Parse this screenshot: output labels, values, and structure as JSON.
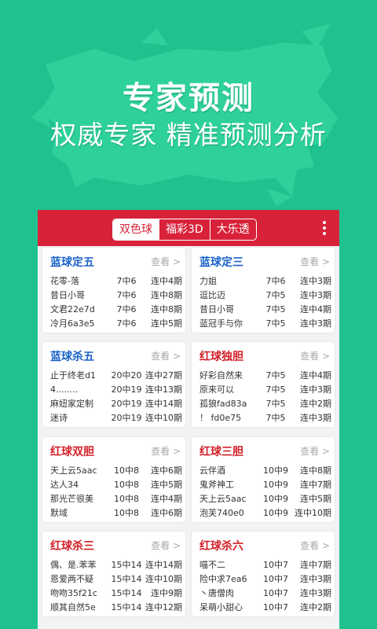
{
  "hero": {
    "title": "专家预测",
    "subtitle": "权威专家 精准预测分析"
  },
  "tabs": [
    {
      "label": "双色球",
      "active": true
    },
    {
      "label": "福彩3D",
      "active": false
    },
    {
      "label": "大乐透",
      "active": false
    }
  ],
  "view_label": "查看 >",
  "colors": {
    "background": "#1fc28f",
    "hero_shape": "#2ed19a",
    "header": "#d8223a",
    "blue_title": "#1a62c8",
    "red_title": "#d21f28"
  },
  "cards": [
    {
      "title": "蓝球定五",
      "color": "blue",
      "rows": [
        {
          "name": "花零-落",
          "hits": "7中6",
          "streak": "连中4期"
        },
        {
          "name": "昔日小哥",
          "hits": "7中6",
          "streak": "连中8期"
        },
        {
          "name": "文君22e7d",
          "hits": "7中6",
          "streak": "连中8期"
        },
        {
          "name": "冷月6a3e5",
          "hits": "7中6",
          "streak": "连中5期"
        }
      ]
    },
    {
      "title": "蓝球定三",
      "color": "blue",
      "rows": [
        {
          "name": "力姐",
          "hits": "7中6",
          "streak": "连中3期"
        },
        {
          "name": "逗比迈",
          "hits": "7中5",
          "streak": "连中3期"
        },
        {
          "name": "昔日小哥",
          "hits": "7中5",
          "streak": "连中4期"
        },
        {
          "name": "蓝冠手与你",
          "hits": "7中5",
          "streak": "连中3期"
        }
      ]
    },
    {
      "title": "蓝球杀五",
      "color": "blue",
      "rows": [
        {
          "name": "止于终老d1",
          "hits": "20中20",
          "streak": "连中27期"
        },
        {
          "name": "4........",
          "hits": "20中19",
          "streak": "连中13期"
        },
        {
          "name": "麻妞家定制",
          "hits": "20中19",
          "streak": "连中14期"
        },
        {
          "name": "迷诗",
          "hits": "20中19",
          "streak": "连中10期"
        }
      ]
    },
    {
      "title": "红球独胆",
      "color": "red",
      "rows": [
        {
          "name": "好彩自然来",
          "hits": "7中5",
          "streak": "连中4期"
        },
        {
          "name": "原来可以",
          "hits": "7中5",
          "streak": "连中3期"
        },
        {
          "name": "孤狼fad83a",
          "hits": "7中5",
          "streak": "连中2期"
        },
        {
          "name": "！ fd0e75",
          "hits": "7中5",
          "streak": "连中3期"
        }
      ]
    },
    {
      "title": "红球双胆",
      "color": "red",
      "rows": [
        {
          "name": "天上云5aac",
          "hits": "10中8",
          "streak": "连中6期"
        },
        {
          "name": "达人34",
          "hits": "10中8",
          "streak": "连中5期"
        },
        {
          "name": "那光芒很美",
          "hits": "10中8",
          "streak": "连中4期"
        },
        {
          "name": "默域",
          "hits": "10中8",
          "streak": "连中6期"
        }
      ]
    },
    {
      "title": "红球三胆",
      "color": "red",
      "rows": [
        {
          "name": "云伴酒",
          "hits": "10中9",
          "streak": "连中8期"
        },
        {
          "name": "鬼斧神工",
          "hits": "10中9",
          "streak": "连中7期"
        },
        {
          "name": "天上云5aac",
          "hits": "10中9",
          "streak": "连中5期"
        },
        {
          "name": "泡芙740e0",
          "hits": "10中9",
          "streak": "连中10期"
        }
      ]
    },
    {
      "title": "红球杀三",
      "color": "red",
      "rows": [
        {
          "name": "偶、是.苯苯",
          "hits": "15中14",
          "streak": "连中14期"
        },
        {
          "name": "恩爱两不疑",
          "hits": "15中14",
          "streak": "连中10期"
        },
        {
          "name": "吻吻35f21c",
          "hits": "15中14",
          "streak": "连中9期"
        },
        {
          "name": "顺其自然5e",
          "hits": "15中14",
          "streak": "连中12期"
        }
      ]
    },
    {
      "title": "红球杀六",
      "color": "red",
      "rows": [
        {
          "name": "喵不二",
          "hits": "10中7",
          "streak": "连中7期"
        },
        {
          "name": "险中求7ea6",
          "hits": "10中7",
          "streak": "连中3期"
        },
        {
          "name": "丶唐僧肉",
          "hits": "10中7",
          "streak": "连中3期"
        },
        {
          "name": "呆萌小甜心",
          "hits": "10中7",
          "streak": "连中2期"
        }
      ]
    }
  ]
}
